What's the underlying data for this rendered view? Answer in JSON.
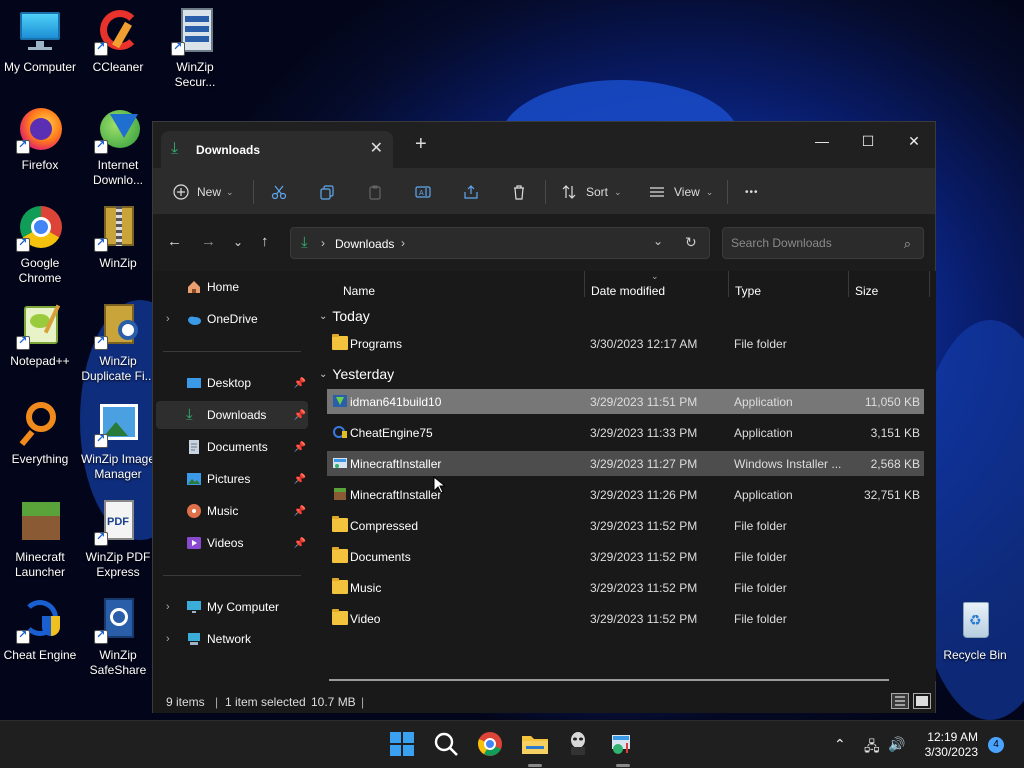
{
  "desktop": {
    "icons": [
      {
        "label": "My Computer",
        "icon": "monitor-icon"
      },
      {
        "label": "CCleaner",
        "icon": "ccleaner-icon"
      },
      {
        "label": "WinZip Secur...",
        "icon": "winzip-secure-icon"
      },
      {
        "label": "Firefox",
        "icon": "firefox-icon"
      },
      {
        "label": "Internet Downlo...",
        "icon": "idm-icon"
      },
      {
        "label": "Google Chrome",
        "icon": "chrome-icon"
      },
      {
        "label": "WinZip",
        "icon": "winzip-icon"
      },
      {
        "label": "Notepad++",
        "icon": "notepad-plus-plus-icon"
      },
      {
        "label": "WinZip Duplicate Fi...",
        "icon": "winzip-duplicate-icon"
      },
      {
        "label": "Everything",
        "icon": "everything-search-icon"
      },
      {
        "label": "WinZip Image Manager",
        "icon": "winzip-image-icon"
      },
      {
        "label": "Minecraft Launcher",
        "icon": "minecraft-icon"
      },
      {
        "label": "WinZip PDF Express",
        "icon": "pdf-icon"
      },
      {
        "label": "Cheat Engine",
        "icon": "cheat-engine-icon"
      },
      {
        "label": "WinZip SafeShare",
        "icon": "share-icon"
      },
      {
        "label": "Recycle Bin",
        "icon": "recycle-bin-icon"
      }
    ]
  },
  "window": {
    "tab_title": "Downloads",
    "new_tab": "+",
    "controls": {
      "minimize": "—",
      "maximize": "☐",
      "close": "✕"
    }
  },
  "toolbar": {
    "new_label": "New",
    "sort_label": "Sort",
    "view_label": "View",
    "more_label": "•••"
  },
  "address": {
    "path": "Downloads",
    "search_placeholder": "Search Downloads"
  },
  "sidebar": {
    "top": [
      {
        "label": "Home",
        "expandable": false
      },
      {
        "label": "OneDrive",
        "expandable": true
      }
    ],
    "quick": [
      {
        "label": "Desktop",
        "pinned": true
      },
      {
        "label": "Downloads",
        "pinned": true,
        "selected": true
      },
      {
        "label": "Documents",
        "pinned": true
      },
      {
        "label": "Pictures",
        "pinned": true
      },
      {
        "label": "Music",
        "pinned": true
      },
      {
        "label": "Videos",
        "pinned": true
      }
    ],
    "bottom": [
      {
        "label": "My Computer",
        "expandable": true
      },
      {
        "label": "Network",
        "expandable": true
      }
    ]
  },
  "columns": {
    "name": "Name",
    "date": "Date modified",
    "type": "Type",
    "size": "Size"
  },
  "groups": {
    "today": {
      "label": "Today",
      "files": [
        {
          "name": "Programs",
          "date": "3/30/2023 12:17 AM",
          "type": "File folder",
          "size": "",
          "kind": "folder"
        }
      ]
    },
    "yesterday": {
      "label": "Yesterday",
      "files": [
        {
          "name": "idman641build10",
          "date": "3/29/2023 11:51 PM",
          "type": "Application",
          "size": "11,050 KB",
          "kind": "app",
          "state": "selected"
        },
        {
          "name": "CheatEngine75",
          "date": "3/29/2023 11:33 PM",
          "type": "Application",
          "size": "3,151 KB",
          "kind": "app"
        },
        {
          "name": "MinecraftInstaller",
          "date": "3/29/2023 11:27 PM",
          "type": "Windows Installer ...",
          "size": "2,568 KB",
          "kind": "msi",
          "state": "hover"
        },
        {
          "name": "MinecraftInstaller",
          "date": "3/29/2023 11:26 PM",
          "type": "Application",
          "size": "32,751 KB",
          "kind": "minecraft"
        },
        {
          "name": "Compressed",
          "date": "3/29/2023 11:52 PM",
          "type": "File folder",
          "size": "",
          "kind": "folder"
        },
        {
          "name": "Documents",
          "date": "3/29/2023 11:52 PM",
          "type": "File folder",
          "size": "",
          "kind": "folder"
        },
        {
          "name": "Music",
          "date": "3/29/2023 11:52 PM",
          "type": "File folder",
          "size": "",
          "kind": "folder"
        },
        {
          "name": "Video",
          "date": "3/29/2023 11:52 PM",
          "type": "File folder",
          "size": "",
          "kind": "folder"
        }
      ]
    }
  },
  "status": {
    "items": "9 items",
    "selected": "1 item selected",
    "size": "10.7 MB"
  },
  "taskbar": {
    "time": "12:19 AM",
    "date": "3/30/2023",
    "notifications": "4"
  }
}
